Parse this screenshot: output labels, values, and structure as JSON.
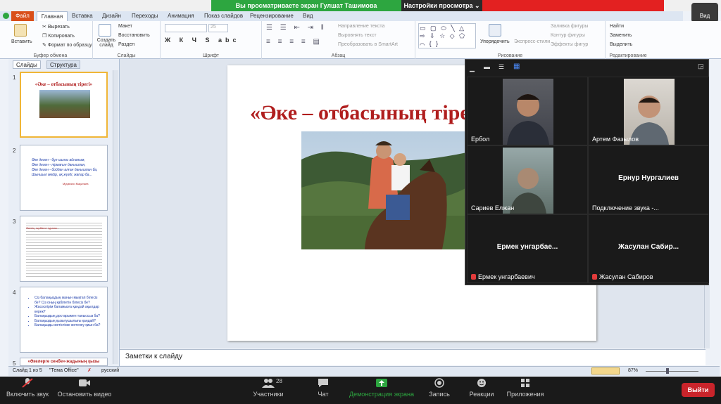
{
  "zoom": {
    "share_text": "Вы просматриваете экран Гулшат Ташимова",
    "view_options": "Настройки просмотра ⌄",
    "view_label": "Вид",
    "toolbar": {
      "mute": "Включить звук",
      "video": "Остановить видео",
      "participants": "Участники",
      "participants_count": "28",
      "chat": "Чат",
      "share": "Демонстрация экрана",
      "record": "Запись",
      "reactions": "Реакции",
      "apps": "Приложения",
      "end": "Выйти"
    },
    "participants": [
      {
        "name": "Ербол"
      },
      {
        "name": "Артем Фазылов"
      },
      {
        "name": "Сариев Елжан"
      },
      {
        "name": "Подключение звука -...",
        "big": "Ернур Нургалиев"
      },
      {
        "name": "Ермек унгарбаевич",
        "big": "Ермек унгарбае..."
      },
      {
        "name": "Жасулан Сабиров",
        "big": "Жасулан Сабир..."
      }
    ],
    "colors": {
      "share_green": "#2da640",
      "end_red": "#c9242b"
    }
  },
  "ppt": {
    "tabs": [
      "Файл",
      "Главная",
      "Вставка",
      "Дизайн",
      "Переходы",
      "Анимация",
      "Показ слайдов",
      "Рецензирование",
      "Вид"
    ],
    "ribbon": {
      "paste": "Вставить",
      "cut": "Вырезать",
      "copy": "Копировать",
      "format_painter": "Формат по образцу",
      "clipboard": "Буфер обмена",
      "new_slide": "Создать слайд",
      "layout": "Макет",
      "reset": "Восстановить",
      "section": "Раздел",
      "slides": "Слайды",
      "font": "Шрифт",
      "font_size": "25",
      "paragraph": "Абзац",
      "text_direction": "Направление текста",
      "align_text": "Выровнять текст",
      "smartart": "Преобразовать в SmartArt",
      "arrange": "Упорядочить",
      "quick_styles": "Экспресс-стили",
      "shape_fill": "Заливка фигуры",
      "shape_outline": "Контур фигуры",
      "shape_effects": "Эффекты фигур",
      "drawing": "Рисование",
      "find": "Найти",
      "replace": "Заменить",
      "select": "Выделить",
      "editing": "Редактирование"
    },
    "pane_tabs": {
      "slides": "Слайды",
      "outline": "Структура"
    },
    "thumbs": {
      "t1_title": "«Әке – отбасының тірегі»",
      "t2_lines": [
        "Әке деген - бұл шыны айналым,",
        "Әке деген - пірмағын данышпан,",
        "Әке деген - бойдан алған данышпан ба,",
        "Шыншыл мейір, ақ жүзді, жапар ба..."
      ],
      "t2_sub": "Мұқағали Мақатаев",
      "t3_text": "Әкенің тәрбиесі туралы...",
      "t4_items": [
        "Сіз балаңыздың жанын мықтап білесіз бе? Сіз оның қабілетін білесіз бе?",
        "Жасөспірім баламызға қандай ақылдар керек?",
        "Балаңыздың достарымен таныссыз ба?",
        "Балаңыздың қызығушылығы қандай?",
        "Балаңызды жетістікке жетелеу қиын ба?"
      ],
      "t5_title": "«Әкелерге сенбе»-жадының қызы"
    },
    "slide_title": "«Әке – отбасының тірегі»",
    "notes": "Заметки к слайду",
    "status": {
      "slide_of": "Слайд 1 из 5",
      "theme": "\"Тема Office\"",
      "lang": "русский",
      "zoom": "87%"
    }
  }
}
